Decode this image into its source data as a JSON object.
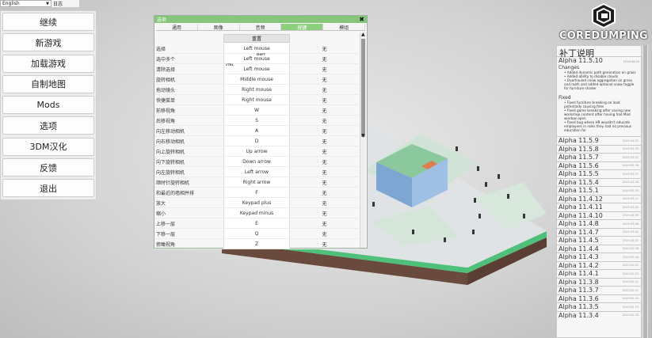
{
  "topbar": {
    "language": "English",
    "log_label": "日志"
  },
  "main_menu": [
    {
      "label": "继续"
    },
    {
      "label": "新游戏"
    },
    {
      "label": "加载游戏"
    },
    {
      "label": "自制地图"
    },
    {
      "label": "Mods"
    },
    {
      "label": "选项"
    },
    {
      "label": "3DM汉化"
    },
    {
      "label": "反馈"
    },
    {
      "label": "退出"
    }
  ],
  "options": {
    "title": "选项",
    "close": "✖",
    "tabs": [
      {
        "label": "通用",
        "active": false
      },
      {
        "label": "图像",
        "active": false
      },
      {
        "label": "音频",
        "active": false
      },
      {
        "label": "按键",
        "active": true
      },
      {
        "label": "模组",
        "active": false
      }
    ],
    "reset_label": "重置",
    "keys": [
      {
        "name": "选择",
        "primary": "Left mouse",
        "modifier": "",
        "alt": "无"
      },
      {
        "name": "选中多个",
        "primary": "Left mouse",
        "modifier": "SHIFT",
        "alt": "无"
      },
      {
        "name": "清除选择",
        "primary": "Left mouse",
        "modifier": "CTRL",
        "alt": "无"
      },
      {
        "name": "旋转相机",
        "primary": "Middle mouse",
        "modifier": "",
        "alt": "无"
      },
      {
        "name": "拖动镜头",
        "primary": "Right mouse",
        "modifier": "",
        "alt": "无"
      },
      {
        "name": "快捷菜单",
        "primary": "Right mouse",
        "modifier": "",
        "alt": "无"
      },
      {
        "name": "前移视角",
        "primary": "W",
        "modifier": "",
        "alt": "无"
      },
      {
        "name": "后移视角",
        "primary": "S",
        "modifier": "",
        "alt": "无"
      },
      {
        "name": "向左移动相机",
        "primary": "A",
        "modifier": "",
        "alt": "无"
      },
      {
        "name": "向右移动相机",
        "primary": "D",
        "modifier": "",
        "alt": "无"
      },
      {
        "name": "向上旋转相机",
        "primary": "Up arrow",
        "modifier": "",
        "alt": "无"
      },
      {
        "name": "向下旋转相机",
        "primary": "Down arrow",
        "modifier": "",
        "alt": "无"
      },
      {
        "name": "向左旋转相机",
        "primary": "Left arrow",
        "modifier": "",
        "alt": "无"
      },
      {
        "name": "顺时针旋转相机",
        "primary": "Right arrow",
        "modifier": "",
        "alt": "无"
      },
      {
        "name": "和最近的墙相并排",
        "primary": "F",
        "modifier": "",
        "alt": "无"
      },
      {
        "name": "放大",
        "primary": "Keypad plus",
        "modifier": "",
        "alt": "无"
      },
      {
        "name": "缩小",
        "primary": "Keypad minus",
        "modifier": "",
        "alt": "无"
      },
      {
        "name": "上移一层",
        "primary": "E",
        "modifier": "",
        "alt": "无"
      },
      {
        "name": "下移一层",
        "primary": "Q",
        "modifier": "",
        "alt": "无"
      },
      {
        "name": "俯瞰视角",
        "primary": "Z",
        "modifier": "",
        "alt": "无"
      }
    ]
  },
  "logo": {
    "text": "COREDUMPING"
  },
  "patch_notes": {
    "title": "补丁说明",
    "current": {
      "version": "Alpha 11.5.10",
      "date": "2019-04-03",
      "changes_title": "Changes",
      "changes": [
        "• Added dynamic path generation on grass",
        "• Added ability to disable clouds",
        "• Overhauled snow aggregation on grass and roofs and added optional snow toggle for furniture shader"
      ],
      "fixed_title": "Fixed",
      "fixed": [
        "• Fixed furniture breaking on load potentially causing fires",
        "• Fixed game breaking after saving new workshop content after having had Mod window open",
        "• Fixed bug where HR wouldn't educate employees in roles they had no previous education for"
      ]
    },
    "versions": [
      {
        "name": "Alpha 11.5.9",
        "date": "2019-04-01"
      },
      {
        "name": "Alpha 11.5.8",
        "date": "2019-03-30"
      },
      {
        "name": "Alpha 11.5.7",
        "date": "2019-03-29"
      },
      {
        "name": "Alpha 11.5.6",
        "date": "2019-03-28"
      },
      {
        "name": "Alpha 11.5.5",
        "date": "2019-03-27"
      },
      {
        "name": "Alpha 11.5.4",
        "date": "2019-03-26"
      },
      {
        "name": "Alpha 11.5.1",
        "date": "2019-03-25"
      },
      {
        "name": "Alpha 11.4.12",
        "date": "2019-03-12"
      },
      {
        "name": "Alpha 11.4.11",
        "date": "2019-03-09"
      },
      {
        "name": "Alpha 11.4.10",
        "date": "2019-03-08"
      },
      {
        "name": "Alpha 11.4.8",
        "date": "2019-03-06"
      },
      {
        "name": "Alpha 11.4.7",
        "date": "2019-03-05"
      },
      {
        "name": "Alpha 11.4.5",
        "date": "2019-03-01"
      },
      {
        "name": "Alpha 11.4.4",
        "date": "2019-02-28"
      },
      {
        "name": "Alpha 11.4.3",
        "date": "2019-02-26"
      },
      {
        "name": "Alpha 11.4.2",
        "date": "2019-02-25"
      },
      {
        "name": "Alpha 11.4.1",
        "date": "2019-02-23"
      },
      {
        "name": "Alpha 11.3.8",
        "date": "2019-02-22"
      },
      {
        "name": "Alpha 11.3.7",
        "date": "2019-02-21"
      },
      {
        "name": "Alpha 11.3.6",
        "date": "2019-02-20"
      },
      {
        "name": "Alpha 11.3.5",
        "date": "2019-02-19"
      },
      {
        "name": "Alpha 11.3.4",
        "date": "2019-02-18"
      }
    ]
  },
  "colors": {
    "accent_green": "#86c57a",
    "tab_active": "#8ccf7e",
    "island_grass": "#5fe18c",
    "island_soil": "#6b4a3e",
    "building": "#6f9ac9"
  }
}
